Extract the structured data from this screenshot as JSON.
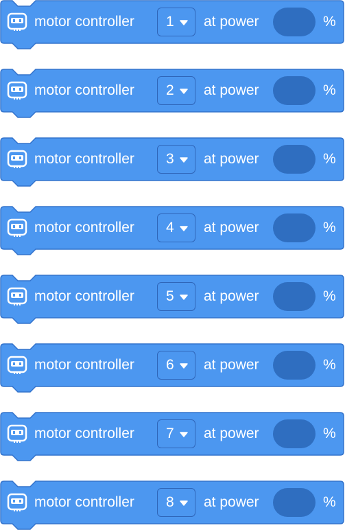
{
  "colors": {
    "block_fill": "#4c97f0",
    "block_stroke": "#3373cc",
    "power_input_fill": "#2f6ec0",
    "text": "#ffffff"
  },
  "icons": {
    "block": "robot-face-icon",
    "dropdown": "caret-down-icon"
  },
  "blocks": [
    {
      "label": "motor controller",
      "port": "1",
      "power_label": "at power",
      "power_value": "",
      "unit": "%"
    },
    {
      "label": "motor controller",
      "port": "2",
      "power_label": "at power",
      "power_value": "",
      "unit": "%"
    },
    {
      "label": "motor controller",
      "port": "3",
      "power_label": "at power",
      "power_value": "",
      "unit": "%"
    },
    {
      "label": "motor controller",
      "port": "4",
      "power_label": "at power",
      "power_value": "",
      "unit": "%"
    },
    {
      "label": "motor controller",
      "port": "5",
      "power_label": "at power",
      "power_value": "",
      "unit": "%"
    },
    {
      "label": "motor controller",
      "port": "6",
      "power_label": "at power",
      "power_value": "",
      "unit": "%"
    },
    {
      "label": "motor controller",
      "port": "7",
      "power_label": "at power",
      "power_value": "",
      "unit": "%"
    },
    {
      "label": "motor controller",
      "port": "8",
      "power_label": "at power",
      "power_value": "",
      "unit": "%"
    }
  ]
}
